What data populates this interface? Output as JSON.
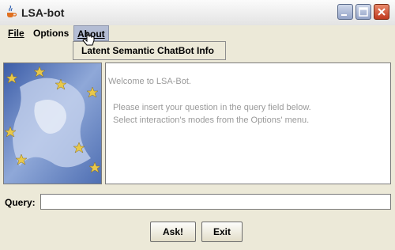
{
  "window": {
    "title": "LSA-bot",
    "app_icon": "java-cup-icon"
  },
  "menubar": {
    "file": "File",
    "options": "Options",
    "about": "About"
  },
  "about_menu": {
    "items": [
      "Latent Semantic ChatBot Info"
    ]
  },
  "chat": {
    "lines": [
      "Welcome to LSA-Bot.",
      "Please insert your question in the query field below.",
      "Select interaction's modes from the Options' menu."
    ],
    "text_color": "#9a9a9a"
  },
  "query": {
    "label": "Query:",
    "value": ""
  },
  "buttons": {
    "ask": "Ask!",
    "exit": "Exit"
  },
  "image": {
    "description_icon": "eu-flag-map-image"
  }
}
